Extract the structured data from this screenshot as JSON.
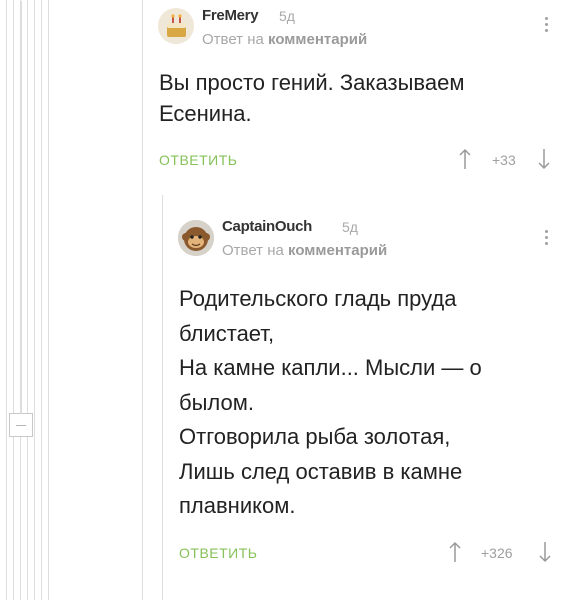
{
  "comments": [
    {
      "author": "FreMery",
      "age": "5д",
      "reply_prefix": "Ответ на",
      "reply_link": "комментарий",
      "text_lines": [
        "Вы просто гений. Заказываем",
        "Есенина."
      ],
      "reply_label": "ОТВЕТИТЬ",
      "rating": "+33"
    },
    {
      "author": "CaptainOuch",
      "age": "5д",
      "reply_prefix": "Ответ на",
      "reply_link": "комментарий",
      "text_lines": [
        "Родительского гладь пруда",
        "блистает,",
        "На камне капли... Мысли — о",
        "былом.",
        "Отговорила рыба золотая,",
        "Лишь след оставив в камне",
        "плавником."
      ],
      "reply_label": "ОТВЕТИТЬ",
      "rating": "+326"
    }
  ],
  "colors": {
    "reply": "#86c25a",
    "muted": "#a8a8a8",
    "line": "#dddddd"
  }
}
